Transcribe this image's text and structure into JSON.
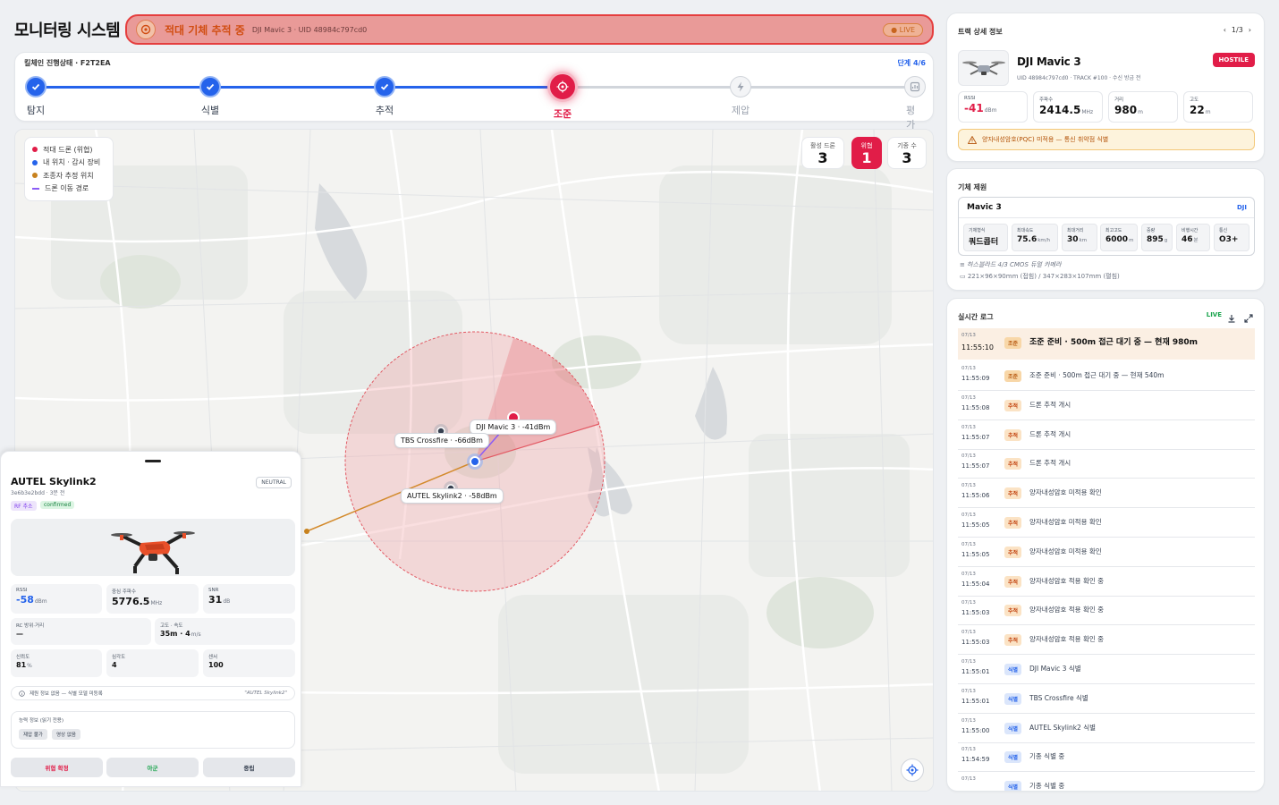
{
  "app": {
    "title": "모니터링 시스템"
  },
  "alert": {
    "title": "적대 기체 추적 중",
    "subtitle": "DJI Mavic 3 · UID 48984c797cd0",
    "live": "● LIVE"
  },
  "killchain": {
    "title": "킬체인 진행상태 · F2T2EA",
    "step_label": "단계 4/6",
    "steps": [
      {
        "label": "탐지",
        "state": "done"
      },
      {
        "label": "식별",
        "state": "done"
      },
      {
        "label": "추적",
        "state": "done"
      },
      {
        "label": "조준",
        "state": "active"
      },
      {
        "label": "제압",
        "state": "pending"
      },
      {
        "label": "평가",
        "state": "pending"
      }
    ]
  },
  "map": {
    "legend": [
      {
        "label": "적대 드론 (위협)",
        "color": "#e11d48",
        "kind": "dot"
      },
      {
        "label": "내 위치 · 감시 장비",
        "color": "#2563eb",
        "kind": "dot"
      },
      {
        "label": "조종자 추정 위치",
        "color": "#c8821e",
        "kind": "dot"
      },
      {
        "label": "드론 이동 경로",
        "color": "#8b5cf6",
        "kind": "dash"
      }
    ],
    "stats": [
      {
        "label": "활성 드론",
        "value": "3"
      },
      {
        "label": "위협",
        "value": "1"
      },
      {
        "label": "기종 수",
        "value": "3"
      }
    ],
    "labels": {
      "mavic": "DJI Mavic 3 · -41dBm",
      "tbs": "TBS Crossfire · -66dBm",
      "autel": "AUTEL Skylink2 · -58dBm"
    }
  },
  "sheet": {
    "name": "AUTEL Skylink2",
    "sub": "3e6b3e2bdd · 3분 전",
    "status": "NEUTRAL",
    "tags": [
      "RF 추소",
      "confirmed"
    ],
    "metrics": {
      "rssi": {
        "label": "RSSI",
        "value": "-58",
        "unit": "dBm"
      },
      "freq": {
        "label": "중심 주파수",
        "value": "5776.5",
        "unit": "MHz"
      },
      "snr": {
        "label": "SNR",
        "value": "31",
        "unit": "dB"
      },
      "rc": {
        "label": "RC 방위·거리",
        "value": "—"
      },
      "alt": {
        "label": "고도 · 속도",
        "value": "35m · 4",
        "unit": "m/s"
      },
      "conf": {
        "label": "신뢰도",
        "value": "81",
        "unit": "%"
      },
      "sev": {
        "label": "심각도",
        "value": "4"
      },
      "sensor": {
        "label": "센서",
        "value": "100"
      }
    },
    "warn": "제원 정보 없음 — 식별 모델 미등록",
    "warn_right": "\"AUTEL Skylink2\"",
    "cap_label": "능력 정보 (읽기 전용)",
    "cap_chips": [
      "제압 불가",
      "영상 없음"
    ],
    "buttons": [
      "위협 확정",
      "아군",
      "중립"
    ]
  },
  "track": {
    "title": "트랙 상세 정보",
    "pager": "1/3",
    "name": "DJI Mavic 3",
    "uid": "UID 48984c797cd0 · TRACK #100 · 수신 방금 전",
    "badge": "HOSTILE",
    "metrics": [
      {
        "label": "RSSI",
        "value": "-41",
        "unit": "dBm"
      },
      {
        "label": "주파수",
        "value": "2414.5",
        "unit": "MHz"
      },
      {
        "label": "거리",
        "value": "980",
        "unit": "m"
      },
      {
        "label": "고도",
        "value": "22",
        "unit": "m"
      }
    ],
    "warn": "양자내성암호(PQC) 미적용 — 통신 취약점 식별"
  },
  "spec": {
    "title": "기체 제원",
    "model": "Mavic 3",
    "brand": "DJI",
    "cells": [
      {
        "label": "기체형식",
        "value": "쿼드콥터",
        "unit": ""
      },
      {
        "label": "최대속도",
        "value": "75.6",
        "unit": "km/h"
      },
      {
        "label": "최대거리",
        "value": "30",
        "unit": "km"
      },
      {
        "label": "최고고도",
        "value": "6000",
        "unit": "m"
      },
      {
        "label": "중량",
        "value": "895",
        "unit": "g"
      },
      {
        "label": "비행시간",
        "value": "46",
        "unit": "분"
      },
      {
        "label": "통신",
        "value": "O3+",
        "unit": ""
      }
    ],
    "camera": "하스블라드 4/3 CMOS 듀얼 카메라",
    "size": "221×96×90mm (접힘) / 347×283×107mm (펼침)"
  },
  "log": {
    "title": "실시간 로그",
    "live": "LIVE",
    "rows": [
      {
        "date": "07/13",
        "time": "11:55:10",
        "badge": "조준",
        "kind": "aim",
        "msg": "조준 준비 · 500m 접근 대기 중 — 현재 980m"
      },
      {
        "date": "07/13",
        "time": "11:55:09",
        "badge": "조준",
        "kind": "aim",
        "msg": "조준 준비 · 500m 접근 대기 중 — 현재 540m"
      },
      {
        "date": "07/13",
        "time": "11:55:08",
        "badge": "추적",
        "kind": "track",
        "msg": "드론 추적 개시"
      },
      {
        "date": "07/13",
        "time": "11:55:07",
        "badge": "추적",
        "kind": "track",
        "msg": "드론 추적 개시"
      },
      {
        "date": "07/13",
        "time": "11:55:07",
        "badge": "추적",
        "kind": "track",
        "msg": "드론 추적 개시"
      },
      {
        "date": "07/13",
        "time": "11:55:06",
        "badge": "추적",
        "kind": "track",
        "msg": "양자내성암호 미적용 확인"
      },
      {
        "date": "07/13",
        "time": "11:55:05",
        "badge": "추적",
        "kind": "track",
        "msg": "양자내성암호 미적용 확인"
      },
      {
        "date": "07/13",
        "time": "11:55:05",
        "badge": "추적",
        "kind": "track",
        "msg": "양자내성암호 미적용 확인"
      },
      {
        "date": "07/13",
        "time": "11:55:04",
        "badge": "추적",
        "kind": "track",
        "msg": "양자내성암호 적용 확인 중"
      },
      {
        "date": "07/13",
        "time": "11:55:03",
        "badge": "추적",
        "kind": "track",
        "msg": "양자내성암호 적용 확인 중"
      },
      {
        "date": "07/13",
        "time": "11:55:03",
        "badge": "추적",
        "kind": "track",
        "msg": "양자내성암호 적용 확인 중"
      },
      {
        "date": "07/13",
        "time": "11:55:01",
        "badge": "식별",
        "kind": "ident",
        "msg": "DJI Mavic 3 식별"
      },
      {
        "date": "07/13",
        "time": "11:55:01",
        "badge": "식별",
        "kind": "ident",
        "msg": "TBS Crossfire 식별"
      },
      {
        "date": "07/13",
        "time": "11:55:00",
        "badge": "식별",
        "kind": "ident",
        "msg": "AUTEL Skylink2 식별"
      },
      {
        "date": "07/13",
        "time": "11:54:59",
        "badge": "식별",
        "kind": "ident",
        "msg": "기종 식별 중"
      },
      {
        "date": "07/13",
        "time": "",
        "badge": "식별",
        "kind": "ident",
        "msg": "기종 식별 중"
      }
    ]
  }
}
